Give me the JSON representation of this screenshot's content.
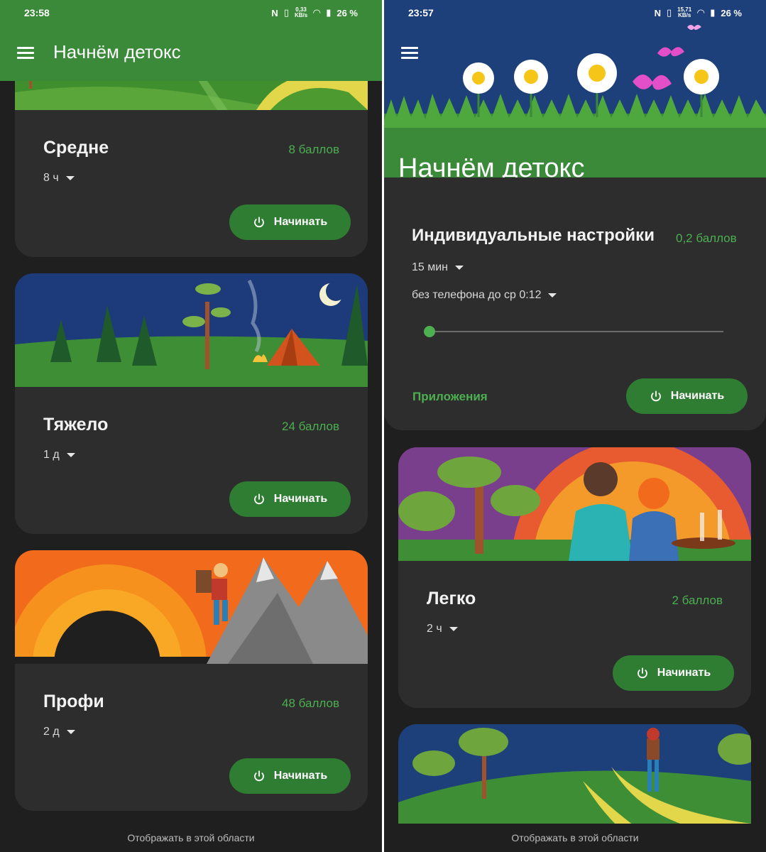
{
  "left": {
    "status": {
      "time": "23:58",
      "net_speed": "0,33",
      "net_unit": "KB/s",
      "battery": "26 %"
    },
    "header_title": "Начнём детокс",
    "cards": [
      {
        "title": "Средне",
        "points": "8 баллов",
        "duration": "8 ч",
        "button": "Начинать"
      },
      {
        "title": "Тяжело",
        "points": "24 баллов",
        "duration": "1 д",
        "button": "Начинать"
      },
      {
        "title": "Профи",
        "points": "48 баллов",
        "duration": "2 д",
        "button": "Начинать"
      }
    ],
    "footer": "Отображать в этой области"
  },
  "right": {
    "status": {
      "time": "23:57",
      "net_speed": "15,71",
      "net_unit": "KB/s",
      "battery": "26 %"
    },
    "header_title": "Начнём детокс",
    "custom": {
      "title": "Индивидуальные настройки",
      "points": "0,2 баллов",
      "duration": "15 мин",
      "no_phone": "без телефона до ср 0:12",
      "slider_value": 0,
      "apps_link": "Приложения",
      "button": "Начинать"
    },
    "cards": [
      {
        "title": "Легко",
        "points": "2 баллов",
        "duration": "2 ч",
        "button": "Начинать"
      }
    ],
    "footer": "Отображать в этой области"
  },
  "colors": {
    "accent": "#4caf50",
    "header": "#3a8a3a",
    "button": "#2e7d32",
    "card": "#2d2d2d",
    "background": "#1f1f1f"
  }
}
